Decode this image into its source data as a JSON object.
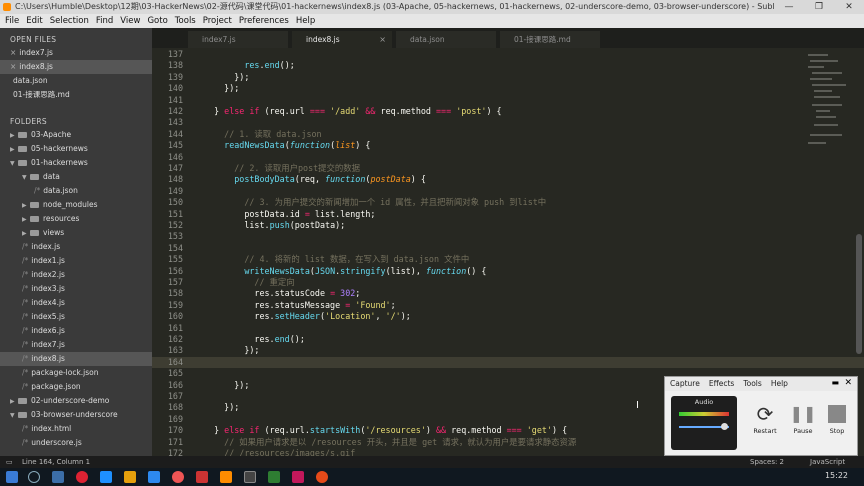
{
  "window": {
    "title": "C:\\Users\\Humble\\Desktop\\12期\\03-HackerNews\\02-源代码\\课堂代码\\01-hackernews\\index8.js (03-Apache, 05-hackernews, 01-hackernews, 02-underscore-demo, 03-browser-underscore) - Sublime Text (UN..."
  },
  "menu": [
    "File",
    "Edit",
    "Selection",
    "Find",
    "View",
    "Goto",
    "Tools",
    "Project",
    "Preferences",
    "Help"
  ],
  "sidebar": {
    "open_files_label": "OPEN FILES",
    "open_files": [
      {
        "name": "index7.js",
        "close": "×"
      },
      {
        "name": "index8.js",
        "close": "×"
      },
      {
        "name": "data.json",
        "close": ""
      },
      {
        "name": "01-接课思路.md",
        "close": ""
      }
    ],
    "folders_label": "FOLDERS",
    "tree": [
      {
        "name": "03-Apache",
        "type": "folder",
        "level": 0,
        "open": false
      },
      {
        "name": "05-hackernews",
        "type": "folder",
        "level": 0,
        "open": false
      },
      {
        "name": "01-hackernews",
        "type": "folder",
        "level": 0,
        "open": true
      },
      {
        "name": "data",
        "type": "folder",
        "level": 1,
        "open": true
      },
      {
        "name": "data.json",
        "type": "file",
        "level": 2
      },
      {
        "name": "node_modules",
        "type": "folder",
        "level": 1,
        "open": false
      },
      {
        "name": "resources",
        "type": "folder",
        "level": 1,
        "open": false
      },
      {
        "name": "views",
        "type": "folder",
        "level": 1,
        "open": false
      },
      {
        "name": "index.js",
        "type": "file",
        "level": 1
      },
      {
        "name": "index1.js",
        "type": "file",
        "level": 1
      },
      {
        "name": "index2.js",
        "type": "file",
        "level": 1
      },
      {
        "name": "index3.js",
        "type": "file",
        "level": 1
      },
      {
        "name": "index4.js",
        "type": "file",
        "level": 1
      },
      {
        "name": "index5.js",
        "type": "file",
        "level": 1
      },
      {
        "name": "index6.js",
        "type": "file",
        "level": 1
      },
      {
        "name": "index7.js",
        "type": "file",
        "level": 1
      },
      {
        "name": "index8.js",
        "type": "file",
        "level": 1,
        "selected": true
      },
      {
        "name": "package-lock.json",
        "type": "file",
        "level": 1
      },
      {
        "name": "package.json",
        "type": "file",
        "level": 1
      },
      {
        "name": "02-underscore-demo",
        "type": "folder",
        "level": 0,
        "open": false
      },
      {
        "name": "03-browser-underscore",
        "type": "folder",
        "level": 0,
        "open": true
      },
      {
        "name": "index.html",
        "type": "file",
        "level": 1
      },
      {
        "name": "underscore.js",
        "type": "file",
        "level": 1
      }
    ]
  },
  "tabs": [
    {
      "label": "index7.js",
      "active": false
    },
    {
      "label": "index8.js",
      "active": true
    },
    {
      "label": "data.json",
      "active": false
    },
    {
      "label": "01-接课思路.md",
      "active": false
    }
  ],
  "editor": {
    "lines": [
      {
        "n": "137",
        "t": ""
      },
      {
        "n": "138",
        "t": "        <span class='fn'>res</span>.<span class='fn'>end</span>();"
      },
      {
        "n": "139",
        "t": "      });"
      },
      {
        "n": "140",
        "t": "    });"
      },
      {
        "n": "141",
        "t": ""
      },
      {
        "n": "142",
        "t": "  } <span class='kw'>else if</span> (req.url <span class='kw'>===</span> <span class='st'>'/add'</span> <span class='kw'>&amp;&amp;</span> req.method <span class='kw'>===</span> <span class='st'>'post'</span>) {"
      },
      {
        "n": "143",
        "t": ""
      },
      {
        "n": "144",
        "t": "    <span class='cm'>// 1. 读取 data.json</span>"
      },
      {
        "n": "145",
        "t": "    <span class='fn'>readNewsData</span>(<span class='it'>function</span>(<span class='pa'>list</span>) {"
      },
      {
        "n": "146",
        "t": ""
      },
      {
        "n": "147",
        "t": "      <span class='cm'>// 2. 读取用户post提交的数据</span>"
      },
      {
        "n": "148",
        "t": "      <span class='fn'>postBodyData</span>(req, <span class='it'>function</span>(<span class='pa'>postData</span>) {"
      },
      {
        "n": "149",
        "t": ""
      },
      {
        "n": "150",
        "t": "        <span class='cm'>// 3. 为用户提交的新闻增加一个 id 属性，并且把新闻对象 push 到list中</span>"
      },
      {
        "n": "151",
        "t": "        postData.id <span class='kw'>=</span> list.length;"
      },
      {
        "n": "152",
        "t": "        list.<span class='fn'>push</span>(postData);"
      },
      {
        "n": "153",
        "t": ""
      },
      {
        "n": "154",
        "t": ""
      },
      {
        "n": "155",
        "t": "        <span class='cm'>// 4. 将新的 list 数据，在写入到 data.json 文件中</span>"
      },
      {
        "n": "156",
        "t": "        <span class='fn'>writeNewsData</span>(<span class='fn'>JSON</span>.<span class='fn'>stringify</span>(list), <span class='it'>function</span>() {"
      },
      {
        "n": "157",
        "t": "          <span class='cm'>// 重定向</span>"
      },
      {
        "n": "158",
        "t": "          res.statusCode <span class='kw'>=</span> <span class='nu'>302</span>;"
      },
      {
        "n": "159",
        "t": "          res.statusMessage <span class='kw'>=</span> <span class='st'>'Found'</span>;"
      },
      {
        "n": "160",
        "t": "          res.<span class='fn'>setHeader</span>(<span class='st'>'Location'</span>, <span class='st'>'/'</span>);"
      },
      {
        "n": "161",
        "t": ""
      },
      {
        "n": "162",
        "t": "          res.<span class='fn'>end</span>();"
      },
      {
        "n": "163",
        "t": "        });"
      },
      {
        "n": "164",
        "t": ""
      },
      {
        "n": "165",
        "t": ""
      },
      {
        "n": "166",
        "t": "      });"
      },
      {
        "n": "167",
        "t": ""
      },
      {
        "n": "168",
        "t": "    });"
      },
      {
        "n": "169",
        "t": ""
      },
      {
        "n": "170",
        "t": "  } <span class='kw'>else if</span> (req.url.<span class='fn'>startsWith</span>(<span class='st'>'/resources'</span>) <span class='kw'>&amp;&amp;</span> req.method <span class='kw'>===</span> <span class='st'>'get'</span>) {"
      },
      {
        "n": "171",
        "t": "    <span class='cm'>// 如果用户请求是以 /resources 开头，并且是 get 请求，就认为用户是要请求静态资源</span>"
      },
      {
        "n": "172",
        "t": "    <span class='cm'>// /resources/images/s.gif</span>"
      }
    ],
    "highlight_line": "164"
  },
  "status": {
    "left": "Line 164, Column 1",
    "spaces": "Spaces: 2",
    "syntax": "JavaScript"
  },
  "taskbar": {
    "time": "15:22"
  },
  "recorder": {
    "menu": [
      "Capture",
      "Effects",
      "Tools",
      "Help"
    ],
    "audio_label": "Audio",
    "restart": "Restart",
    "pause": "Pause",
    "stop": "Stop"
  },
  "colors": {
    "editor_bg": "#272822",
    "keyword": "#f92672",
    "function": "#66d9ef",
    "string": "#e6db74",
    "number": "#ae81ff",
    "comment": "#75715e",
    "param": "#fd971f"
  }
}
